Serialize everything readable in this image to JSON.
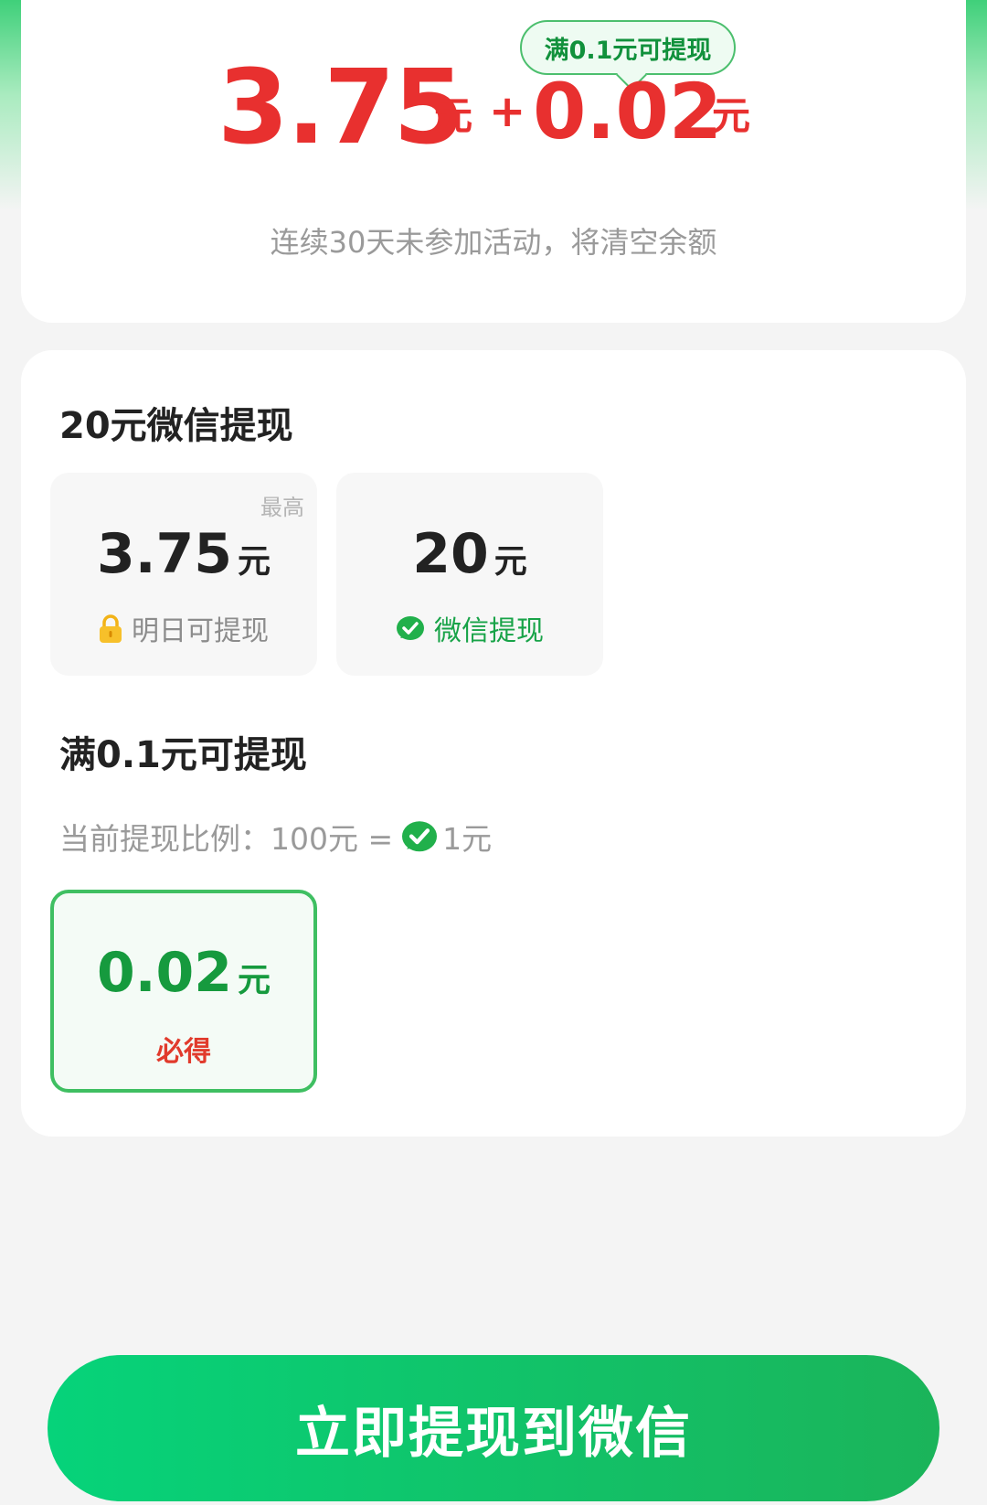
{
  "summary": {
    "tip": "满0.1元可提现",
    "main_amount": "3.75",
    "unit": "元",
    "plus": "+",
    "extra_amount": "0.02",
    "warning": "连续30天未参加活动，将清空余额"
  },
  "tier_section": {
    "title": "20元微信提现",
    "tiles": [
      {
        "note": "最高",
        "value": "3.75",
        "unit": "元",
        "sub": "明日可提现",
        "icon": "lock-icon"
      },
      {
        "value": "20",
        "unit": "元",
        "sub": "微信提现",
        "icon": "wechat-check-icon"
      }
    ]
  },
  "min_section": {
    "title": "满0.1元可提现",
    "ratio_prefix": "当前提现比例：100元 =",
    "ratio_suffix": "1元",
    "tile": {
      "value": "0.02",
      "unit": "元",
      "sub": "必得"
    }
  },
  "button": {
    "label": "立即提现到微信"
  },
  "colors": {
    "accent_green": "#1bb45a",
    "amount_red": "#e8302f",
    "must_red": "#e13a2c"
  }
}
